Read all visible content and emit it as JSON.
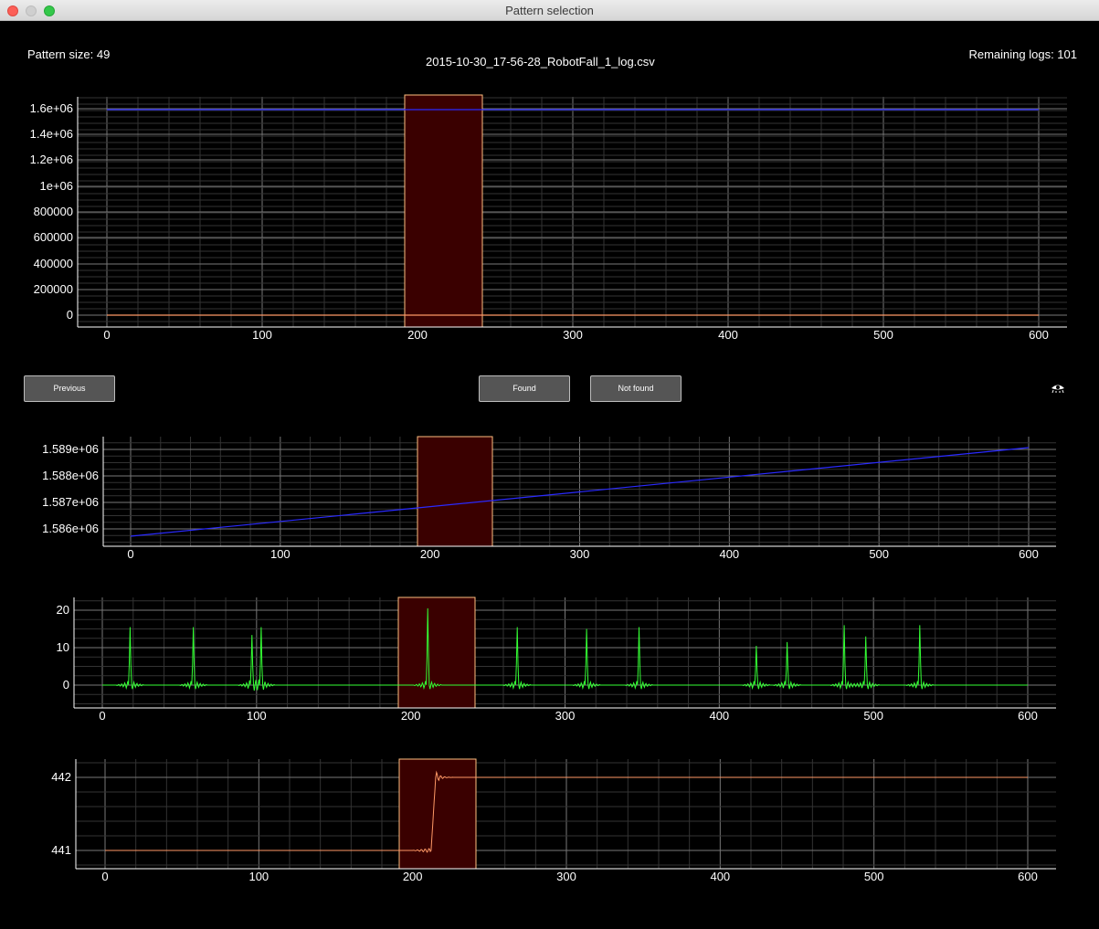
{
  "window": {
    "title": "Pattern selection"
  },
  "header": {
    "pattern_size": "Pattern size: 49",
    "filename": "2015-10-30_17-56-28_RobotFall_1_log.csv",
    "remaining_logs": "Remaining logs: 101"
  },
  "buttons": {
    "previous": "Previous",
    "found": "Found",
    "not_found": "Not found"
  },
  "icons": {
    "visibility": "eye-icon"
  },
  "colors": {
    "background": "#000000",
    "highlight": "#3a0000",
    "highlight_border": "#ffbf80",
    "blue": "#1a1aff",
    "green": "#33ff33",
    "orange": "#ff9966"
  },
  "chart_data": [
    {
      "type": "line",
      "x_range": [
        0,
        600
      ],
      "x_ticks": [
        "0",
        "100",
        "200",
        "300",
        "400",
        "500",
        "600"
      ],
      "y_ticks": [
        "0",
        "200000",
        "400000",
        "600000",
        "800000",
        "1e+06",
        "1.2e+06",
        "1.4e+06",
        "1.6e+06"
      ],
      "ylim": [
        0,
        1600000
      ],
      "selection": [
        192,
        242
      ],
      "series": [
        {
          "color": "#1a1aff",
          "points": [
            [
              0,
              1585700
            ],
            [
              600,
              1589100
            ]
          ]
        },
        {
          "color": "#ff9966",
          "points": [
            [
              0,
              441
            ],
            [
              600,
              442
            ]
          ]
        }
      ]
    },
    {
      "type": "line",
      "x_range": [
        0,
        600
      ],
      "x_ticks": [
        "0",
        "100",
        "200",
        "300",
        "400",
        "500",
        "600"
      ],
      "y_ticks": [
        "1.586e+06",
        "1.587e+06",
        "1.588e+06",
        "1.589e+06"
      ],
      "ylim": [
        1586000,
        1589000
      ],
      "selection": [
        192,
        242
      ],
      "series": [
        {
          "color": "#1a1aff",
          "points": [
            [
              0,
              1585750
            ],
            [
              600,
              1589100
            ]
          ]
        }
      ]
    },
    {
      "type": "line",
      "x_range": [
        0,
        600
      ],
      "x_ticks": [
        "0",
        "100",
        "200",
        "300",
        "400",
        "500",
        "600"
      ],
      "y_ticks": [
        "0",
        "10",
        "20"
      ],
      "ylim": [
        0,
        20
      ],
      "selection": [
        192,
        242
      ],
      "series": [
        {
          "color": "#33ff33",
          "spikes": [
            18,
            59,
            97,
            103,
            211,
            269,
            314,
            348,
            424,
            444,
            481,
            495,
            530
          ],
          "spike_heights": [
            15.5,
            15.5,
            13.5,
            15.5,
            20.5,
            15.5,
            15,
            15.5,
            10.5,
            11.5,
            16,
            13,
            16
          ]
        }
      ]
    },
    {
      "type": "line",
      "x_range": [
        0,
        600
      ],
      "x_ticks": [
        "0",
        "100",
        "200",
        "300",
        "400",
        "500",
        "600"
      ],
      "y_ticks": [
        "441",
        "442"
      ],
      "ylim": [
        441,
        442
      ],
      "selection": [
        192,
        242
      ],
      "series": [
        {
          "color": "#ff9966",
          "points": [
            [
              0,
              441
            ],
            [
              210,
              441
            ],
            [
              216,
              442
            ],
            [
              600,
              442
            ]
          ]
        }
      ]
    }
  ]
}
